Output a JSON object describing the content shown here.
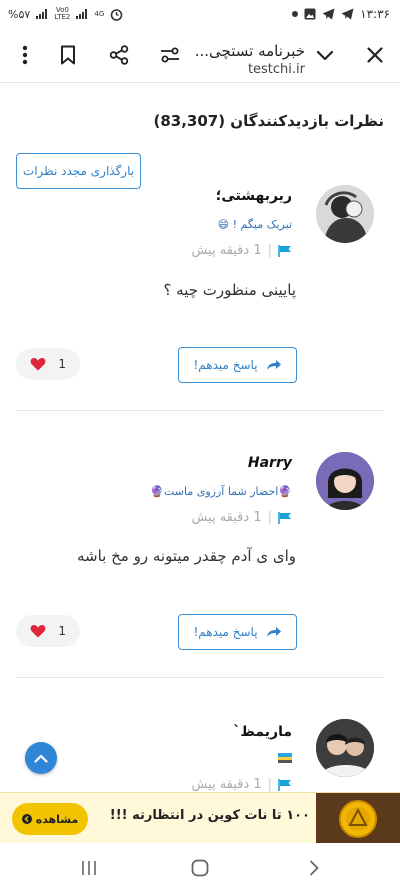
{
  "status_bar": {
    "battery": "%۵۷",
    "signal_label_top": "Vo0",
    "signal_label_bottom": "LTE2",
    "network": "4G",
    "time": "۱۳:۳۶"
  },
  "toolbar": {
    "title": "خبرنامه تستچی...",
    "domain": "testchi.ir"
  },
  "comments_section": {
    "heading": "نظرات بازدیدکنندگان (83,307)",
    "reload_label": "بارگذاری مجدد نظرات",
    "reply_label": "پاسخ میدهم!",
    "comments": [
      {
        "name": "ریربهشتی؛",
        "badge": "تبریک میگم ! 😄",
        "time": "1 دقیقه پیش",
        "text": "پایینی منظورت چیه ؟",
        "likes": "1"
      },
      {
        "name": "Harry",
        "badge": "🔮احضار شما آرزوی ماست🔮",
        "time": "1 دقیقه پیش",
        "text": "وای ی آدم چقدر میتونه رو مخ باشه",
        "likes": "1"
      },
      {
        "name": "ماریمظ`",
        "badge": "",
        "time": "1 دقیقه پیش",
        "text": "",
        "likes": ""
      }
    ]
  },
  "ad_banner": {
    "text": "۱۰۰ تا نات کوین در انتظارته !!!",
    "button_label": "مشاهده"
  },
  "colors": {
    "accent_blue": "#2f80c8",
    "like_red": "#e0243a",
    "ad_yellow": "#f2c400"
  }
}
